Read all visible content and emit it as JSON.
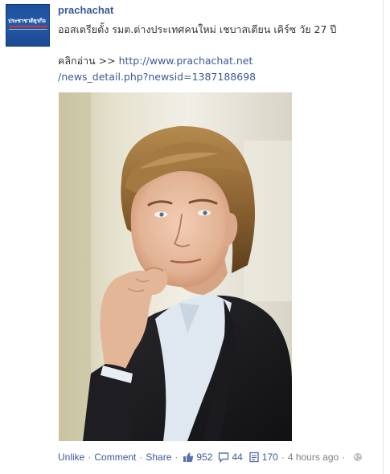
{
  "post": {
    "author": "prachachat",
    "avatar_text": "ประชาชาติธุรกิจ",
    "message": "ออสเตรียตั้ง รมต.ต่างประเทศคนใหม่ เชบาสเตียน เคิร์ซ วัย 27 ปี",
    "link_prefix": "คลิกอ่าน >> ",
    "link_url_line1": "http://www.prachachat.net",
    "link_url_line2": "/news_detail.php?newsid=1387188698"
  },
  "actions": {
    "unlike_label": "Unlike",
    "comment_label": "Comment",
    "share_label": "Share",
    "separator": "·",
    "likes_count": "952",
    "comments_count": "44",
    "shares_count": "170",
    "timestamp": "4 hours ago"
  },
  "icons": {
    "like": "thumbs-up-icon",
    "comments": "speech-bubble-icon",
    "shares": "document-icon",
    "privacy": "globe-icon"
  },
  "colors": {
    "link": "#3b5998",
    "meta": "#808080",
    "avatar_bg": "#1c4f9a"
  }
}
